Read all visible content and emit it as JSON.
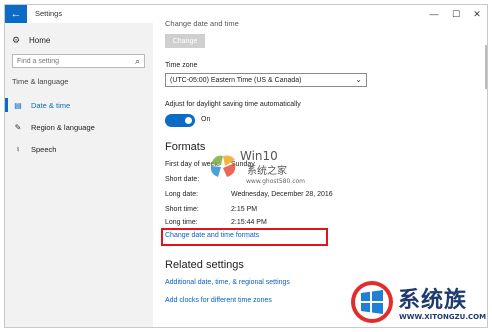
{
  "window": {
    "title": "Settings",
    "controls": {
      "minimize": "—",
      "maximize": "☐",
      "close": "✕"
    }
  },
  "sidebar": {
    "home_label": "Home",
    "search_placeholder": "Find a setting",
    "category": "Time & language",
    "items": [
      {
        "label": "Date & time",
        "icon": "calendar-clock-icon",
        "active": true
      },
      {
        "label": "Region & language",
        "icon": "region-language-icon",
        "active": false
      },
      {
        "label": "Speech",
        "icon": "microphone-icon",
        "active": false
      }
    ]
  },
  "content": {
    "cut_heading": "Change date and time",
    "change_button": "Change",
    "timezone_label": "Time zone",
    "timezone_value": "(UTC-05:00) Eastern Time (US & Canada)",
    "dst_label": "Adjust for daylight saving time automatically",
    "dst_state": "On",
    "formats_heading": "Formats",
    "formats": [
      {
        "label": "First day of week:",
        "value": "Sunday"
      },
      {
        "label": "Short date:",
        "value": ""
      },
      {
        "label": "Long date:",
        "value": "Wednesday, December 28, 2016"
      },
      {
        "label": "Short time:",
        "value": "2:15 PM"
      },
      {
        "label": "Long time:",
        "value": "2:15:44 PM"
      }
    ],
    "change_formats_link": "Change date and time formats",
    "related_heading": "Related settings",
    "related_links": [
      "Additional date, time, & regional settings",
      "Add clocks for different time zones"
    ]
  },
  "watermark": {
    "title": "Win10",
    "subtitle": "系统之家",
    "url": "www.ghost580.com",
    "brand": "系统族",
    "brand_url": "WWW.XITONGZU.COM"
  },
  "colors": {
    "accent": "#0b6bc7",
    "highlight_box": "#e0151a",
    "sidebar_bg": "#f2f2f2"
  }
}
